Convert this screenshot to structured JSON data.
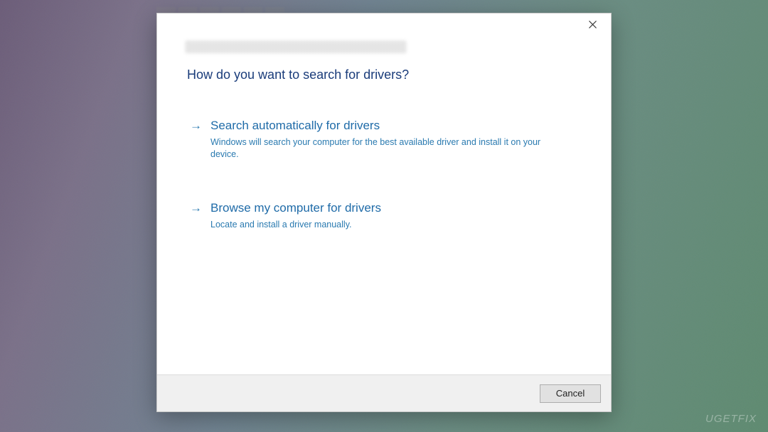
{
  "dialog": {
    "question": "How do you want to search for drivers?",
    "options": [
      {
        "title": "Search automatically for drivers",
        "description": "Windows will search your computer for the best available driver and install it on your device."
      },
      {
        "title": "Browse my computer for drivers",
        "description": "Locate and install a driver manually."
      }
    ],
    "footer": {
      "cancel_label": "Cancel"
    }
  },
  "watermark": "UGETFIX"
}
